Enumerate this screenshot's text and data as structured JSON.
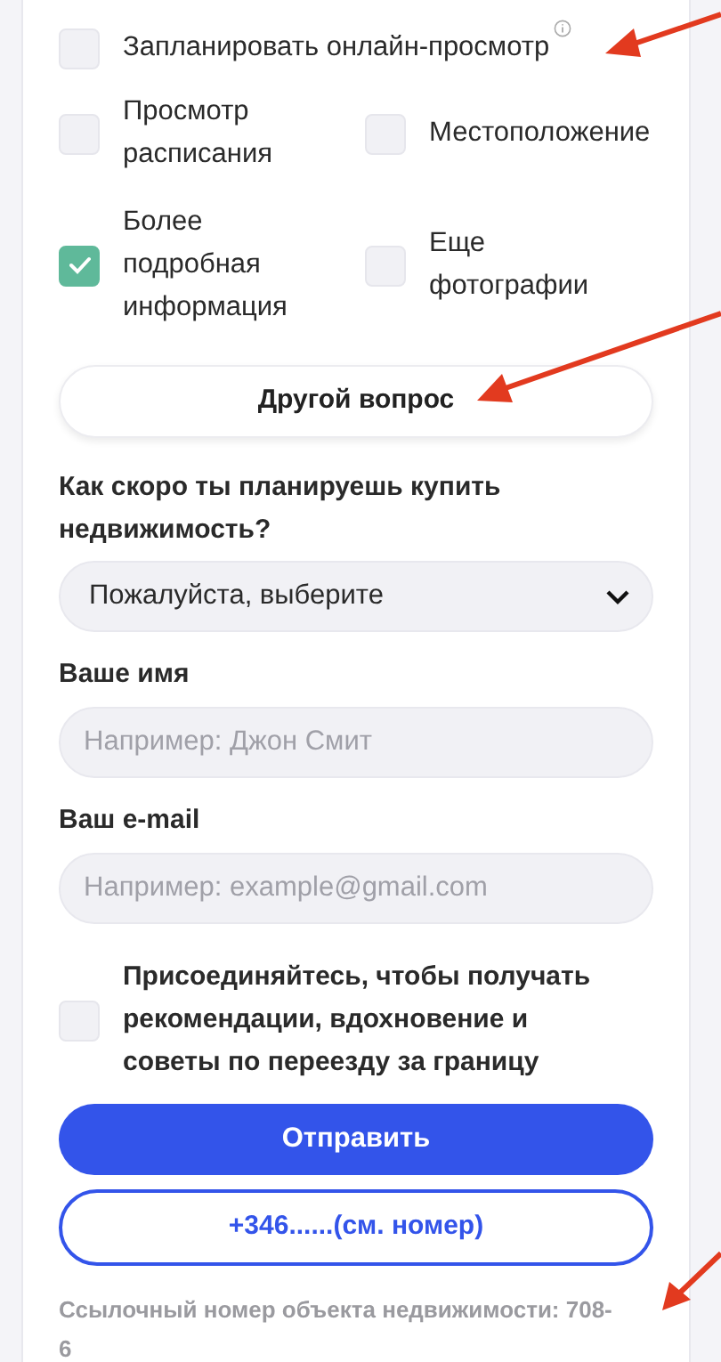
{
  "top_option": {
    "label": "Запланировать онлайн-просмотр",
    "checked": false,
    "info": true
  },
  "options": [
    {
      "label": "Просмотр расписания",
      "checked": false
    },
    {
      "label": "Местоположение",
      "checked": false
    },
    {
      "label": "Более подробная информация",
      "checked": true
    },
    {
      "label": "Еще фотографии",
      "checked": false
    }
  ],
  "other_question_button": "Другой вопрос",
  "timeframe": {
    "label": "Как скоро ты планируешь купить недвижимость?",
    "value": "Пожалуйста, выберите"
  },
  "name_field": {
    "label": "Ваше имя",
    "placeholder": "Например: Джон Смит"
  },
  "email_field": {
    "label": "Ваш e-mail",
    "placeholder": "Например: example@gmail.com"
  },
  "newsletter": {
    "label": "Присоединяйтесь, чтобы получать рекомендации, вдохновение и советы по переезду за границу",
    "checked": false
  },
  "submit_button": "Отправить",
  "phone_button": "+346......(см. номер)",
  "reference": "Ссылочный номер объекта недвижимости: 708-6"
}
